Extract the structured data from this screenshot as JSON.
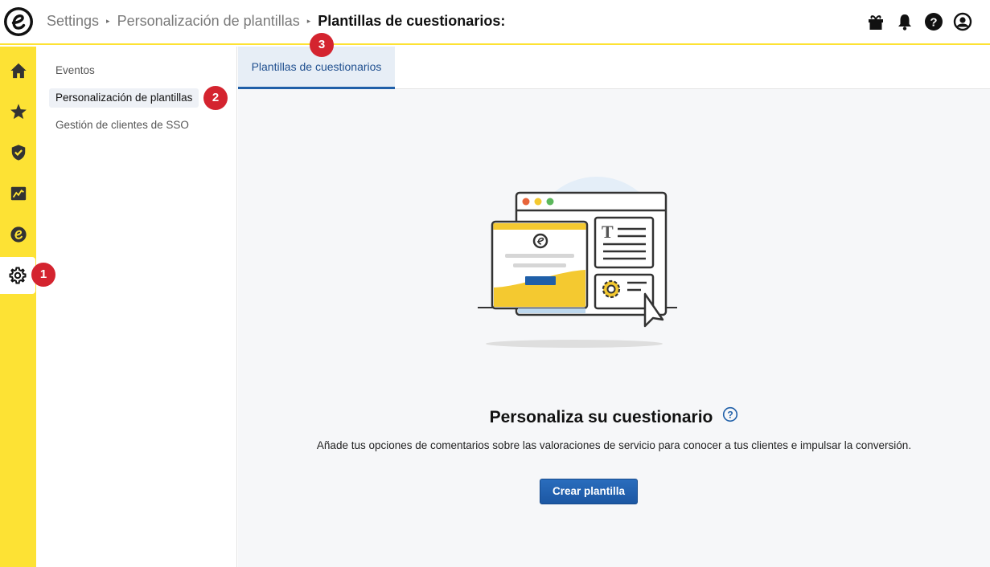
{
  "breadcrumb": {
    "items": [
      "Settings",
      "Personalización de plantillas"
    ],
    "current": "Plantillas de cuestionarios:"
  },
  "top_icons": [
    "gift-icon",
    "bell-icon",
    "help-icon",
    "user-account-icon"
  ],
  "rail": {
    "items": [
      {
        "icon": "home-icon"
      },
      {
        "icon": "star-icon"
      },
      {
        "icon": "shield-check-icon"
      },
      {
        "icon": "analytics-chart-icon"
      },
      {
        "icon": "trustedshops-e-icon"
      },
      {
        "icon": "gear-icon",
        "active": true
      }
    ]
  },
  "sidenav": {
    "items": [
      {
        "label": "Eventos"
      },
      {
        "label": "Personalización de plantillas",
        "active": true
      },
      {
        "label": "Gestión de clientes de SSO"
      }
    ]
  },
  "tabs": [
    {
      "label": "Plantillas de cuestionarios",
      "active": true
    }
  ],
  "empty_state": {
    "title": "Personaliza su cuestionario",
    "description": "Añade tus opciones de comentarios sobre las valoraciones de servicio para conocer a tus clientes e impulsar la conversión.",
    "button_label": "Crear plantilla"
  },
  "step_badges": [
    "1",
    "2",
    "3"
  ],
  "colors": {
    "brand_yellow": "#fde234",
    "primary_blue": "#1c57a3",
    "badge_red": "#d4242f"
  }
}
